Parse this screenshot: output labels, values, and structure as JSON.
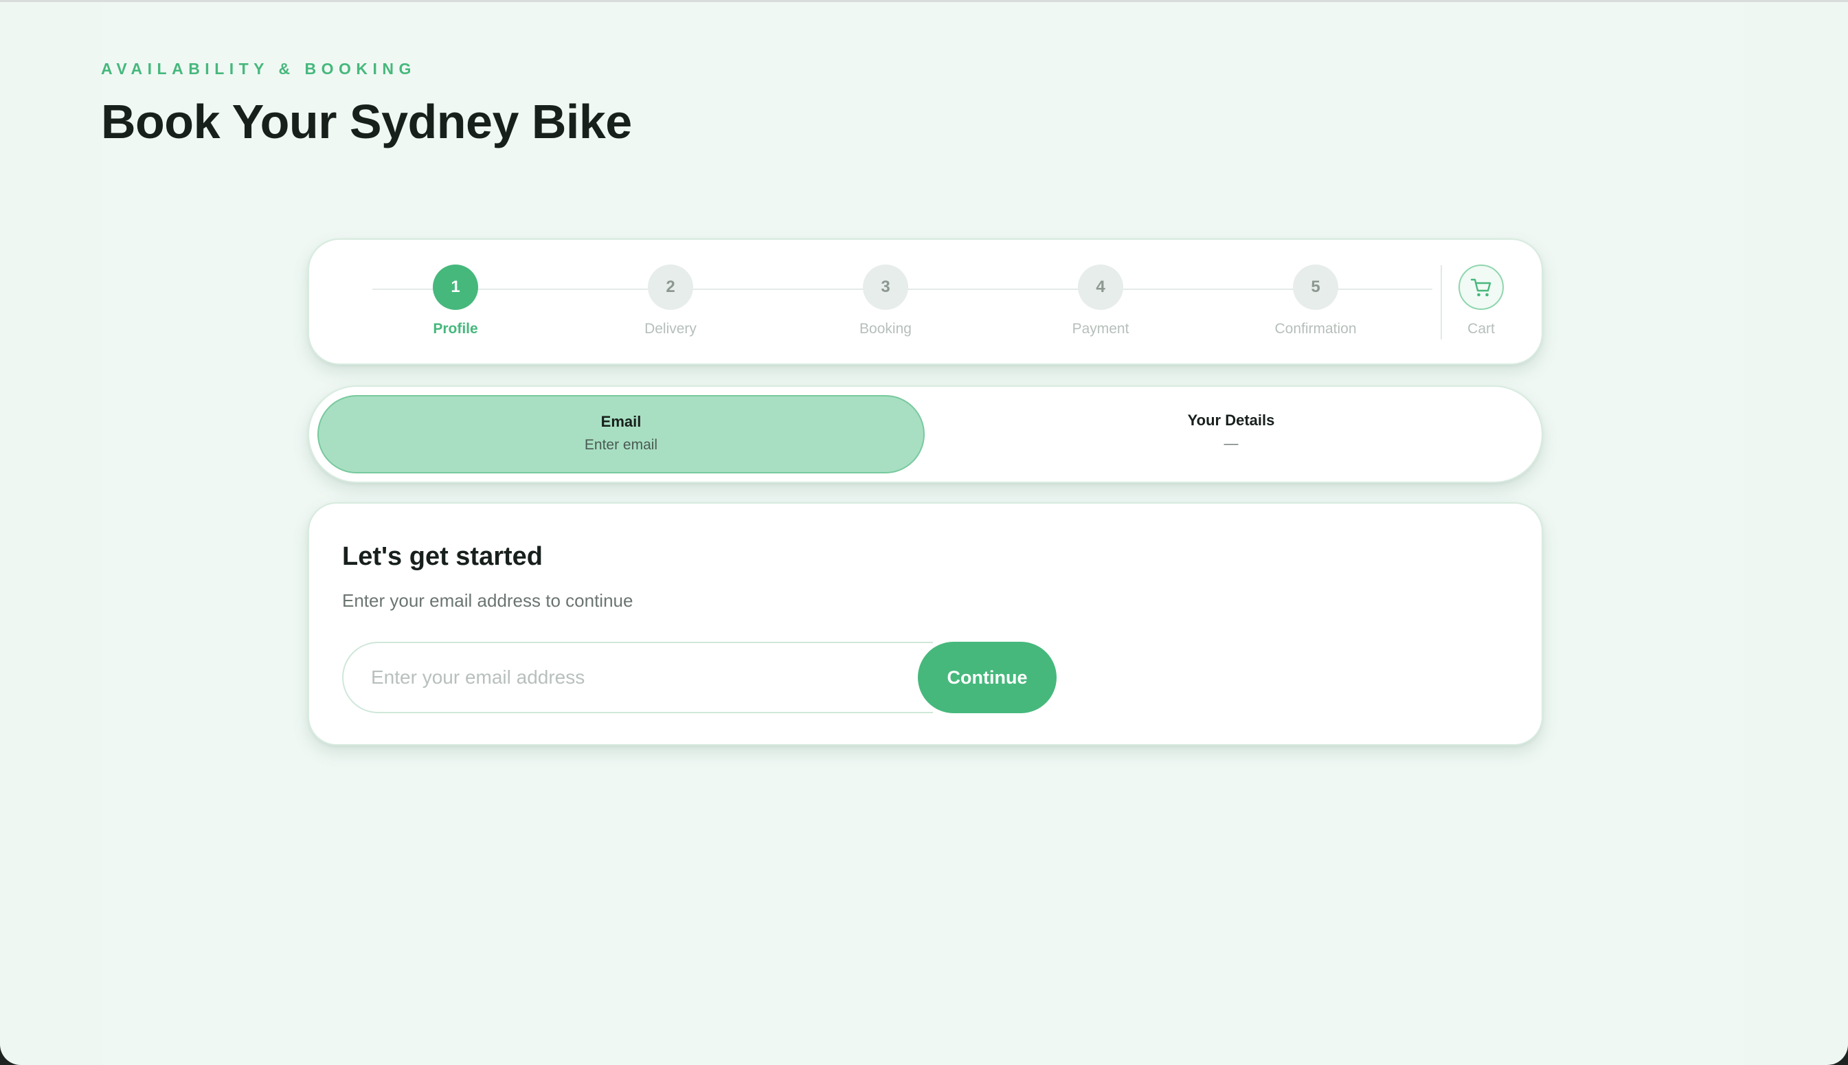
{
  "header": {
    "eyebrow": "AVAILABILITY & BOOKING",
    "title": "Book Your Sydney Bike"
  },
  "stepper": {
    "steps": [
      {
        "number": "1",
        "label": "Profile",
        "state": "active"
      },
      {
        "number": "2",
        "label": "Delivery",
        "state": "upcoming"
      },
      {
        "number": "3",
        "label": "Booking",
        "state": "upcoming"
      },
      {
        "number": "4",
        "label": "Payment",
        "state": "upcoming"
      },
      {
        "number": "5",
        "label": "Confirmation",
        "state": "upcoming"
      }
    ],
    "cart": {
      "label": "Cart",
      "icon": "cart-icon"
    }
  },
  "tabs": [
    {
      "title": "Email",
      "subtitle": "Enter email",
      "active": true
    },
    {
      "title": "Your Details",
      "subtitle": "—",
      "active": false
    }
  ],
  "form": {
    "heading": "Let's get started",
    "subheading": "Enter your email address to continue",
    "email": {
      "value": "",
      "placeholder": "Enter your email address"
    },
    "continue_label": "Continue"
  },
  "colors": {
    "accent": "#46b87c",
    "accent_light": "#a8dfc3",
    "page_background": "#eef7f2",
    "title_text": "#18201c"
  }
}
